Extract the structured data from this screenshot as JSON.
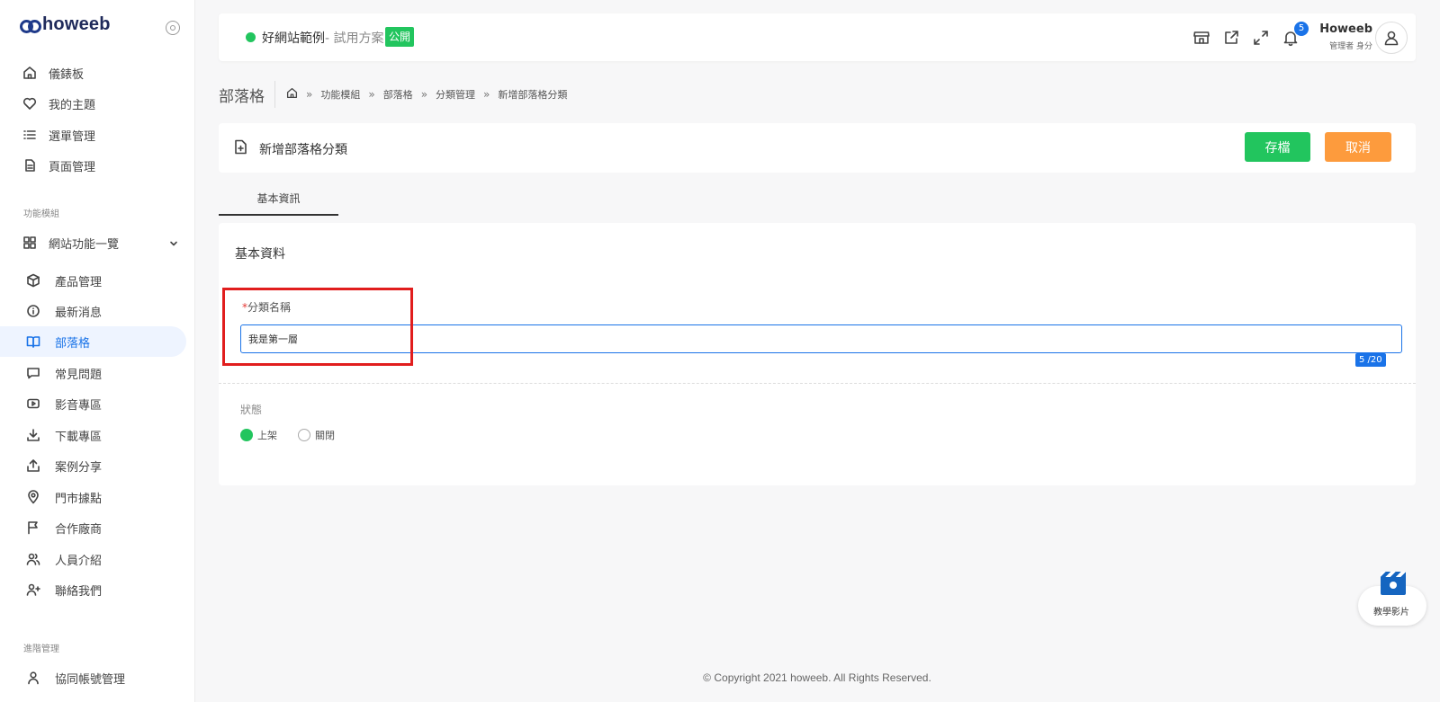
{
  "brand": {
    "logo_text": "howeeb"
  },
  "sidebar": {
    "top_items": [
      {
        "label": "儀錶板",
        "icon": "home-icon"
      },
      {
        "label": "我的主題",
        "icon": "heart-icon"
      },
      {
        "label": "選單管理",
        "icon": "list-icon"
      },
      {
        "label": "頁面管理",
        "icon": "document-icon"
      }
    ],
    "section_modules": "功能模組",
    "modules_group": {
      "label": "網站功能一覽",
      "icon": "grid-icon"
    },
    "module_items": [
      {
        "label": "產品管理",
        "icon": "box-icon"
      },
      {
        "label": "最新消息",
        "icon": "info-icon"
      },
      {
        "label": "部落格",
        "icon": "book-icon",
        "active": true
      },
      {
        "label": "常見問題",
        "icon": "chat-icon"
      },
      {
        "label": "影音專區",
        "icon": "video-icon"
      },
      {
        "label": "下載專區",
        "icon": "download-icon"
      },
      {
        "label": "案例分享",
        "icon": "share-icon"
      },
      {
        "label": "門市據點",
        "icon": "location-icon"
      },
      {
        "label": "合作廠商",
        "icon": "flag-icon"
      },
      {
        "label": "人員介紹",
        "icon": "users-icon"
      },
      {
        "label": "聯絡我們",
        "icon": "user-plus-icon"
      }
    ],
    "section_admin": "進階管理",
    "admin_items": [
      {
        "label": "協同帳號管理",
        "icon": "user-icon"
      }
    ]
  },
  "header": {
    "site_name": "好網站範例",
    "site_plan": "- 試用方案",
    "public_badge": "公開",
    "notification_count": "5",
    "user_name": "Howeeb",
    "user_role": "管理者 身分"
  },
  "breadcrumb": {
    "page_title": "部落格",
    "items": [
      "功能模組",
      "部落格",
      "分類管理",
      "新增部落格分類"
    ]
  },
  "title_card": {
    "title": "新增部落格分類",
    "save_label": "存檔",
    "cancel_label": "取消"
  },
  "tabs": [
    {
      "label": "基本資訊",
      "active": true
    }
  ],
  "form": {
    "section_title": "基本資料",
    "name_required": "*",
    "name_label": "分類名稱",
    "name_value": "我是第一層",
    "char_count": "5 /20",
    "status_label": "狀態",
    "status_options": [
      {
        "label": "上架",
        "checked": true
      },
      {
        "label": "關閉",
        "checked": false
      }
    ]
  },
  "footer": {
    "copyright": "© Copyright 2021 howeeb. All Rights Reserved."
  },
  "tutorial": {
    "label": "教學影片"
  },
  "colors": {
    "accent": "#1a73e8",
    "success": "#22c55e",
    "warning": "#fd9b3d",
    "highlight": "#e11d1d"
  }
}
